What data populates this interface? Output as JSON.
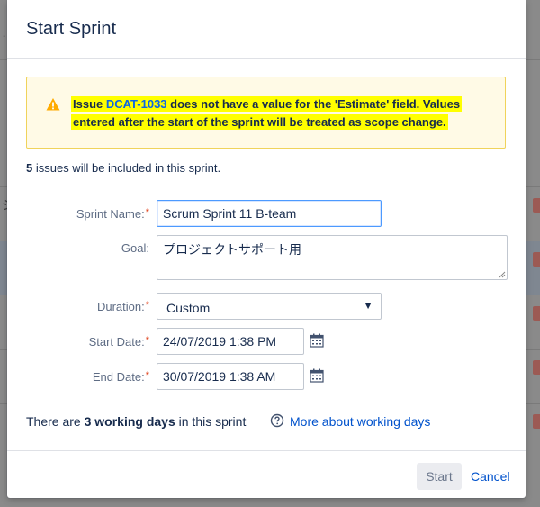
{
  "background": {
    "left_glyph_1": "…",
    "left_glyph_2": "シ"
  },
  "dialog": {
    "title": "Start Sprint",
    "warning": {
      "prefix": "Issue ",
      "issue_key": "DCAT-1033",
      "line1_rest": " does not have a value for the 'Estimate' field. Values",
      "line2": "entered after the start of the sprint will be treated as scope change."
    },
    "summary": {
      "count": "5",
      "text": " issues will be included in this sprint."
    },
    "form": {
      "sprint_name_label": "Sprint Name:",
      "sprint_name_value": "Scrum Sprint 11 B-team",
      "goal_label": "Goal:",
      "goal_value": "プロジェクトサポート用",
      "duration_label": "Duration:",
      "duration_value": "Custom",
      "start_date_label": "Start Date:",
      "start_date_value": "24/07/2019 1:38 PM",
      "end_date_label": "End Date:",
      "end_date_value": "30/07/2019 1:38 AM",
      "required_marker": "*"
    },
    "working_days": {
      "prefix": "There are ",
      "count_text": "3 working days",
      "suffix": " in this sprint",
      "link_label": "More about working days"
    },
    "footer": {
      "start_label": "Start",
      "cancel_label": "Cancel"
    }
  },
  "colors": {
    "warning_bg": "#fffae6",
    "warning_border": "#f0d35b",
    "highlight": "#ffff00",
    "link": "#0052cc",
    "required": "#de350b"
  },
  "icons": [
    "warning-icon",
    "calendar-icon",
    "help-icon",
    "chevron-down-icon"
  ]
}
